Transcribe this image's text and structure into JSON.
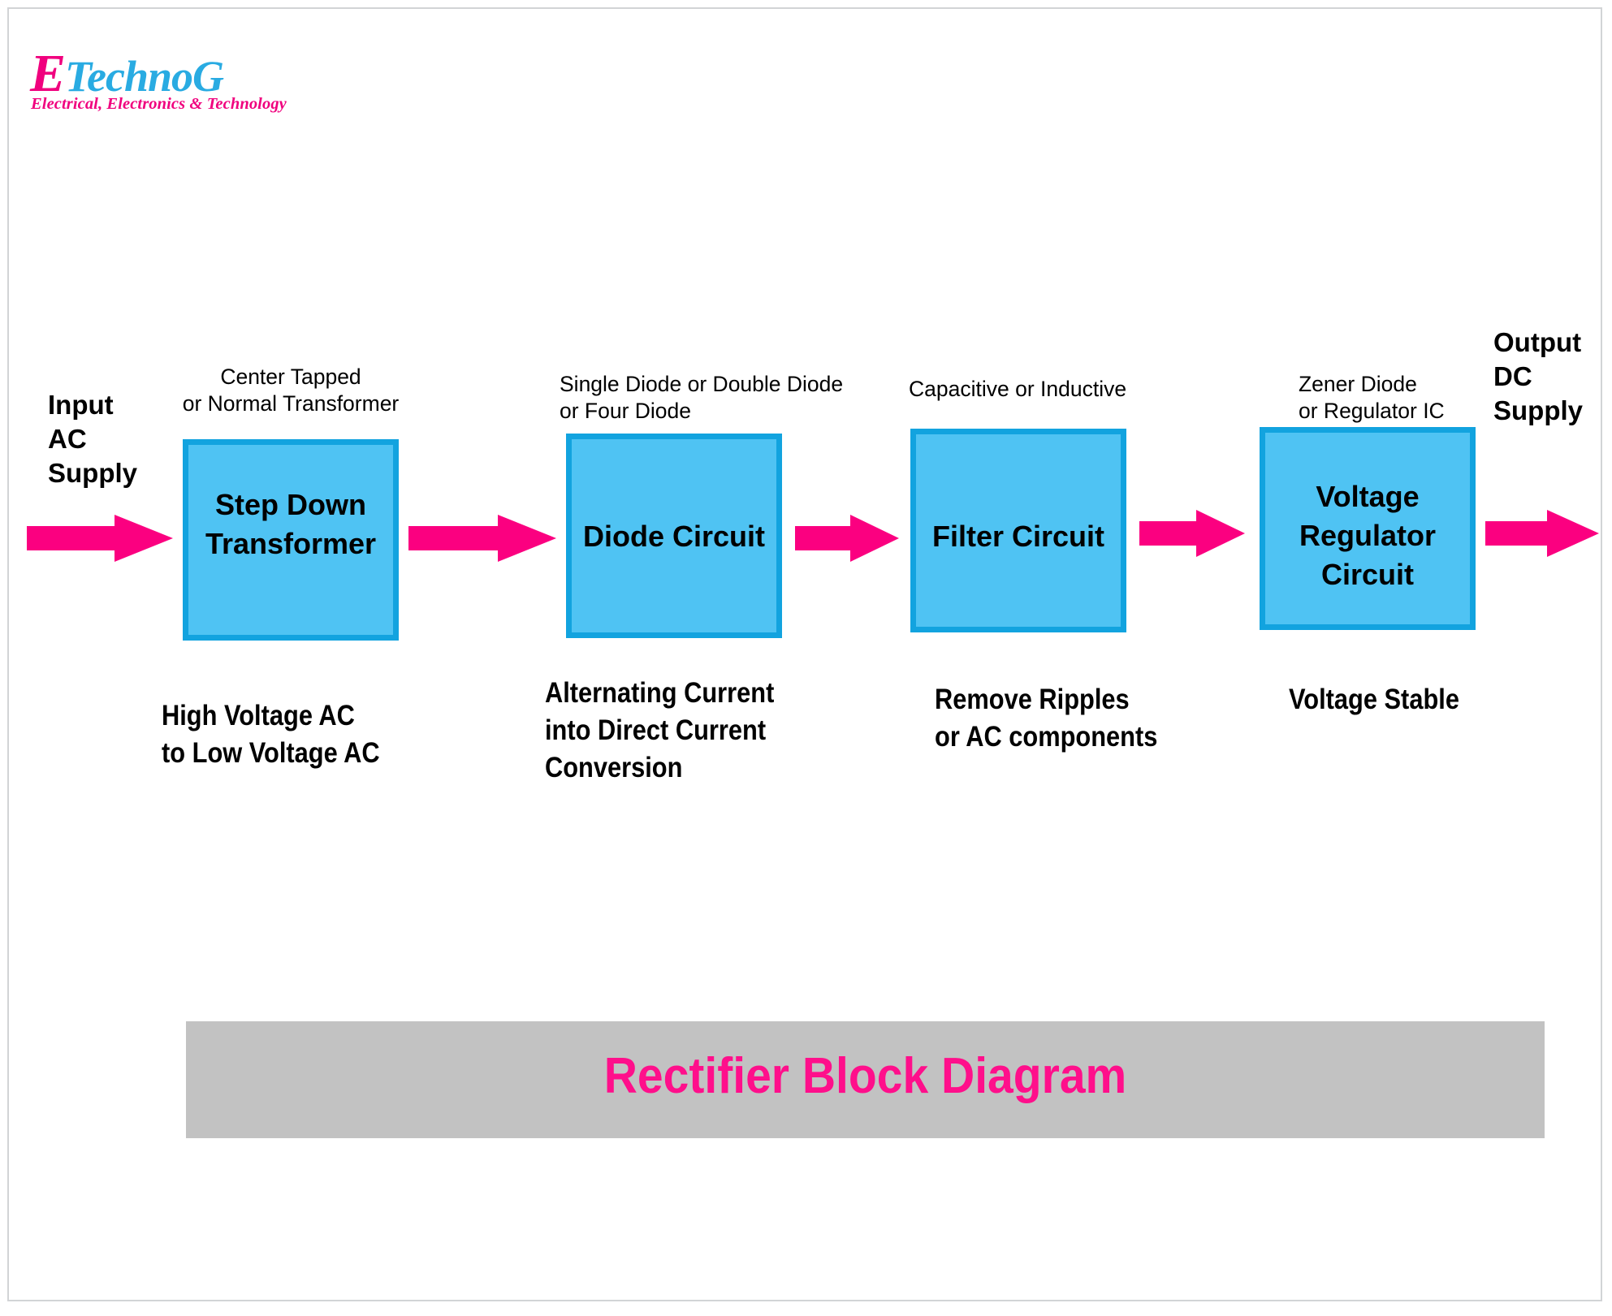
{
  "logo": {
    "initial": "E",
    "word": "TechnoG",
    "tagline": "Electrical, Electronics & Technology"
  },
  "diagram": {
    "title": "Rectifier Block Diagram",
    "input_label": "Input\nAC\nSupply",
    "output_label": "Output\nDC\nSupply",
    "accent_blue_fill": "#4FC3F3",
    "accent_blue_border": "#12A3DF",
    "arrow_color": "#FB0080",
    "title_color": "#FF0F8B",
    "title_band_color": "#C2C2C2",
    "stages": [
      {
        "top_label": "Center Tapped\nor Normal Transformer",
        "block_label": "Step Down\nTransformer",
        "caption": "High Voltage AC\nto Low Voltage AC"
      },
      {
        "top_label": "Single Diode or Double Diode\nor Four Diode",
        "block_label": "Diode Circuit",
        "caption": "Alternating Current\ninto Direct Current\nConversion"
      },
      {
        "top_label": "Capacitive or Inductive",
        "block_label": "Filter Circuit",
        "caption": "Remove Ripples\nor AC components"
      },
      {
        "top_label": "Zener Diode\nor Regulator IC",
        "block_label": "Voltage\nRegulator\nCircuit",
        "caption": "Voltage Stable"
      }
    ]
  }
}
